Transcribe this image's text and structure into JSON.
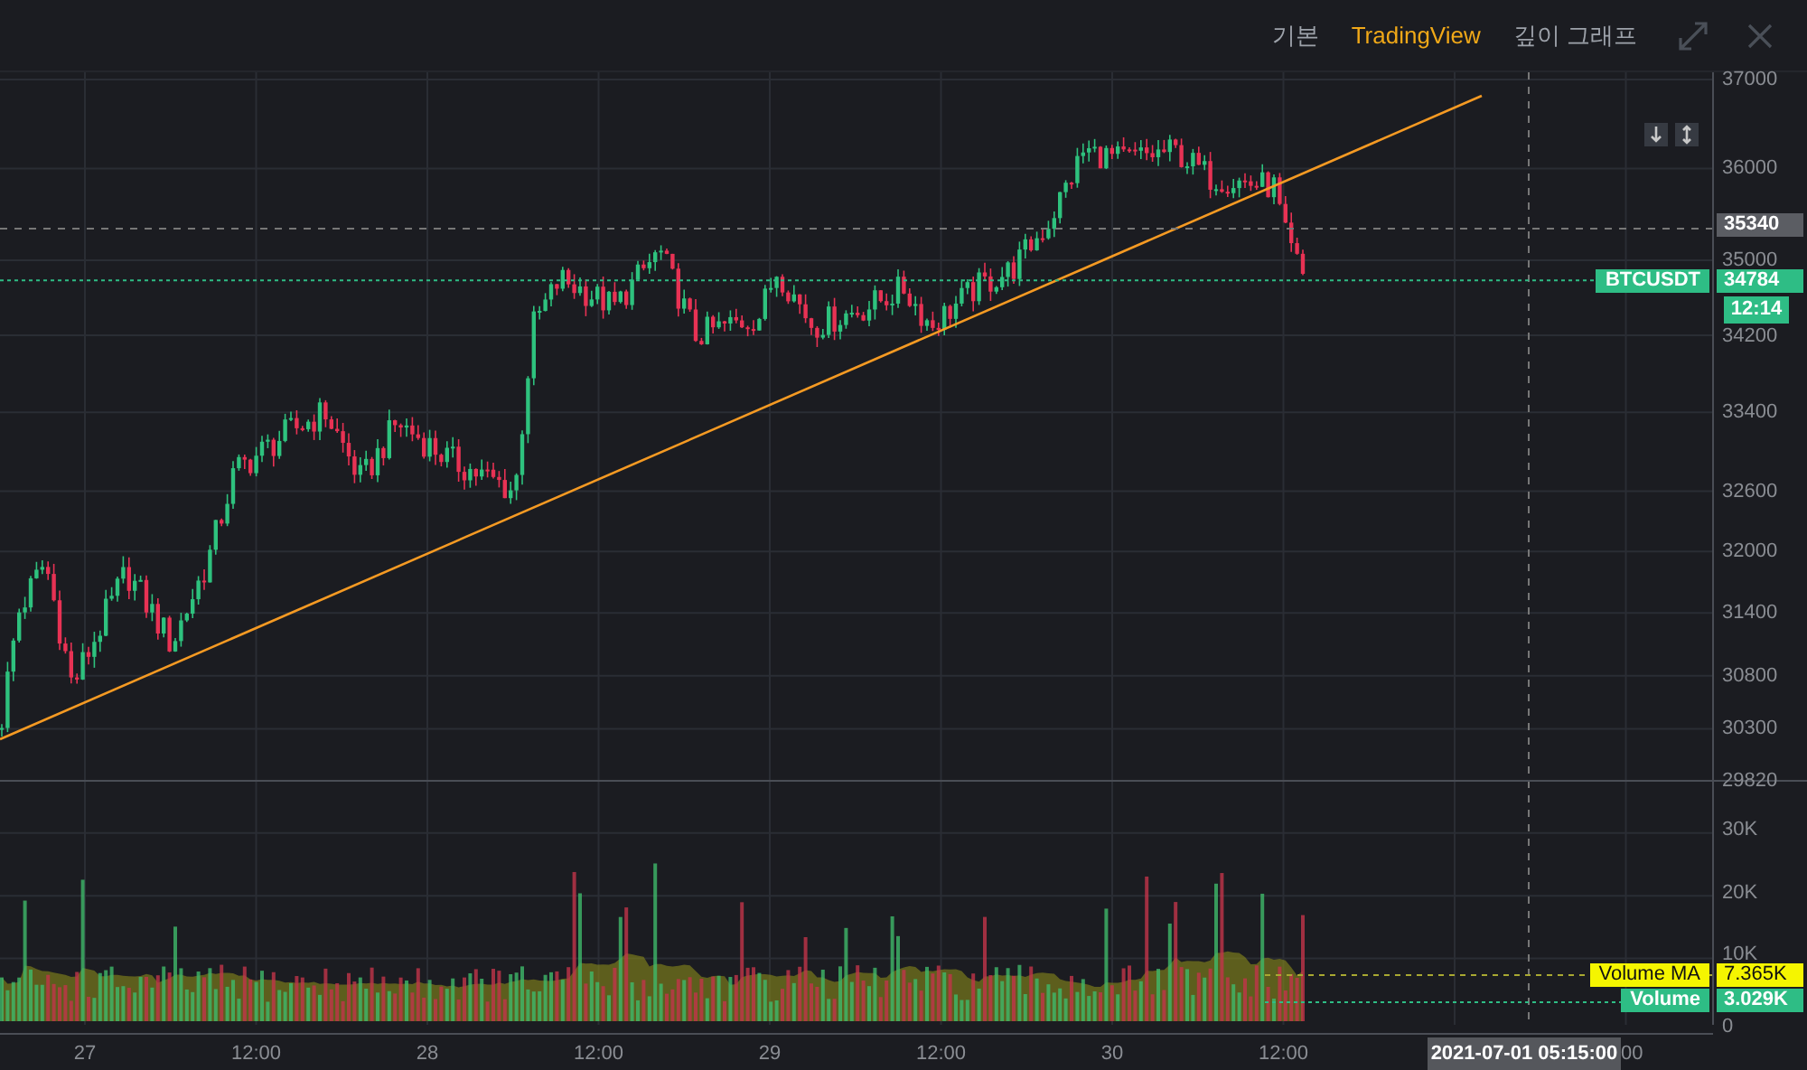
{
  "tabs": [
    {
      "label": "기본",
      "selected": false
    },
    {
      "label": "TradingView",
      "selected": true
    },
    {
      "label": "깊이 그래프",
      "selected": false
    }
  ],
  "price_axis": {
    "labels": [
      "37000",
      "36000",
      "35000",
      "34200",
      "33400",
      "32600",
      "32000",
      "31400",
      "30800",
      "30300",
      "29820"
    ],
    "crosshair_price": "35340",
    "last_price": {
      "symbol": "BTCUSDT",
      "value": "34784",
      "countdown": "12:14"
    }
  },
  "volume_axis": {
    "labels": [
      "30K",
      "20K",
      "10K",
      "0"
    ],
    "volume_ma": {
      "name": "Volume MA",
      "value": "7.365K"
    },
    "volume": {
      "name": "Volume",
      "value": "3.029K"
    }
  },
  "time_axis": {
    "labels": [
      "27",
      "12:00",
      "28",
      "12:00",
      "29",
      "12:00",
      "30",
      "12:00"
    ],
    "crosshair_time": "2021-07-01 05:15:00",
    "partial_label": "00"
  }
}
